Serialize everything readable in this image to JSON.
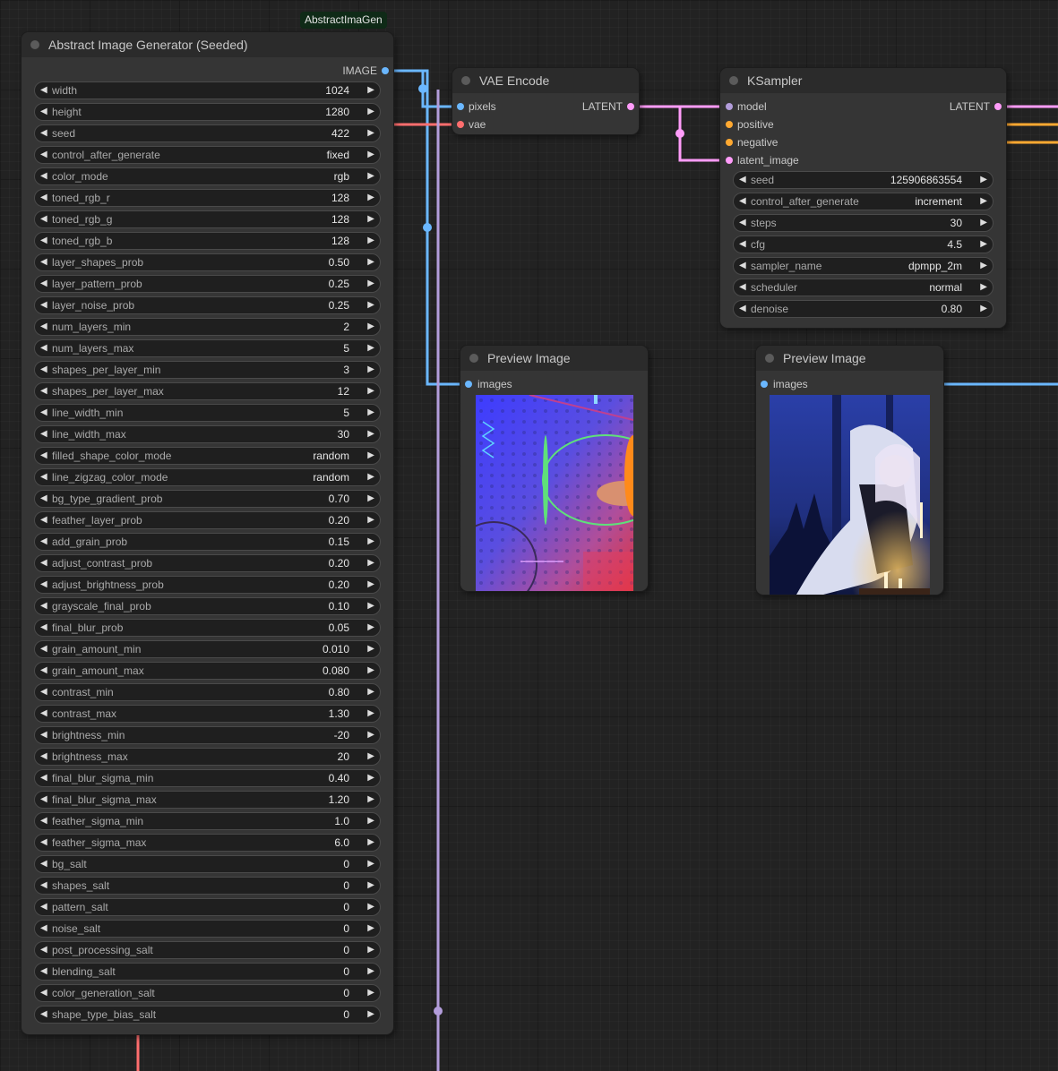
{
  "colors": {
    "image": "#6ab7ff",
    "vae": "#ff6e6e",
    "latent": "#ff9cf9",
    "model": "#b39ddb",
    "conditioning": "#ffa931",
    "badge_bg": "#0f2a17"
  },
  "abstract_node": {
    "badge": "AbstractImaGen",
    "title": "Abstract Image Generator (Seeded)",
    "output_label": "IMAGE",
    "widgets": [
      {
        "label": "width",
        "value": "1024"
      },
      {
        "label": "height",
        "value": "1280"
      },
      {
        "label": "seed",
        "value": "422"
      },
      {
        "label": "control_after_generate",
        "value": "fixed"
      },
      {
        "label": "color_mode",
        "value": "rgb"
      },
      {
        "label": "toned_rgb_r",
        "value": "128"
      },
      {
        "label": "toned_rgb_g",
        "value": "128"
      },
      {
        "label": "toned_rgb_b",
        "value": "128"
      },
      {
        "label": "layer_shapes_prob",
        "value": "0.50"
      },
      {
        "label": "layer_pattern_prob",
        "value": "0.25"
      },
      {
        "label": "layer_noise_prob",
        "value": "0.25"
      },
      {
        "label": "num_layers_min",
        "value": "2"
      },
      {
        "label": "num_layers_max",
        "value": "5"
      },
      {
        "label": "shapes_per_layer_min",
        "value": "3"
      },
      {
        "label": "shapes_per_layer_max",
        "value": "12"
      },
      {
        "label": "line_width_min",
        "value": "5"
      },
      {
        "label": "line_width_max",
        "value": "30"
      },
      {
        "label": "filled_shape_color_mode",
        "value": "random"
      },
      {
        "label": "line_zigzag_color_mode",
        "value": "random"
      },
      {
        "label": "bg_type_gradient_prob",
        "value": "0.70"
      },
      {
        "label": "feather_layer_prob",
        "value": "0.20"
      },
      {
        "label": "add_grain_prob",
        "value": "0.15"
      },
      {
        "label": "adjust_contrast_prob",
        "value": "0.20"
      },
      {
        "label": "adjust_brightness_prob",
        "value": "0.20"
      },
      {
        "label": "grayscale_final_prob",
        "value": "0.10"
      },
      {
        "label": "final_blur_prob",
        "value": "0.05"
      },
      {
        "label": "grain_amount_min",
        "value": "0.010"
      },
      {
        "label": "grain_amount_max",
        "value": "0.080"
      },
      {
        "label": "contrast_min",
        "value": "0.80"
      },
      {
        "label": "contrast_max",
        "value": "1.30"
      },
      {
        "label": "brightness_min",
        "value": "-20"
      },
      {
        "label": "brightness_max",
        "value": "20"
      },
      {
        "label": "final_blur_sigma_min",
        "value": "0.40"
      },
      {
        "label": "final_blur_sigma_max",
        "value": "1.20"
      },
      {
        "label": "feather_sigma_min",
        "value": "1.0"
      },
      {
        "label": "feather_sigma_max",
        "value": "6.0"
      },
      {
        "label": "bg_salt",
        "value": "0"
      },
      {
        "label": "shapes_salt",
        "value": "0"
      },
      {
        "label": "pattern_salt",
        "value": "0"
      },
      {
        "label": "noise_salt",
        "value": "0"
      },
      {
        "label": "post_processing_salt",
        "value": "0"
      },
      {
        "label": "blending_salt",
        "value": "0"
      },
      {
        "label": "color_generation_salt",
        "value": "0"
      },
      {
        "label": "shape_type_bias_salt",
        "value": "0"
      }
    ]
  },
  "vae_encode": {
    "title": "VAE Encode",
    "inputs": [
      "pixels",
      "vae"
    ],
    "output": "LATENT"
  },
  "ksampler": {
    "title": "KSampler",
    "inputs": [
      "model",
      "positive",
      "negative",
      "latent_image"
    ],
    "output": "LATENT",
    "widgets": [
      {
        "label": "seed",
        "value": "125906863554"
      },
      {
        "label": "control_after_generate",
        "value": "increment"
      },
      {
        "label": "steps",
        "value": "30"
      },
      {
        "label": "cfg",
        "value": "4.5"
      },
      {
        "label": "sampler_name",
        "value": "dpmpp_2m"
      },
      {
        "label": "scheduler",
        "value": "normal"
      },
      {
        "label": "denoise",
        "value": "0.80"
      }
    ]
  },
  "preview1": {
    "title": "Preview Image",
    "input": "images"
  },
  "preview2": {
    "title": "Preview Image",
    "input": "images"
  },
  "glyphs": {
    "left": "◀",
    "right": "▶"
  }
}
